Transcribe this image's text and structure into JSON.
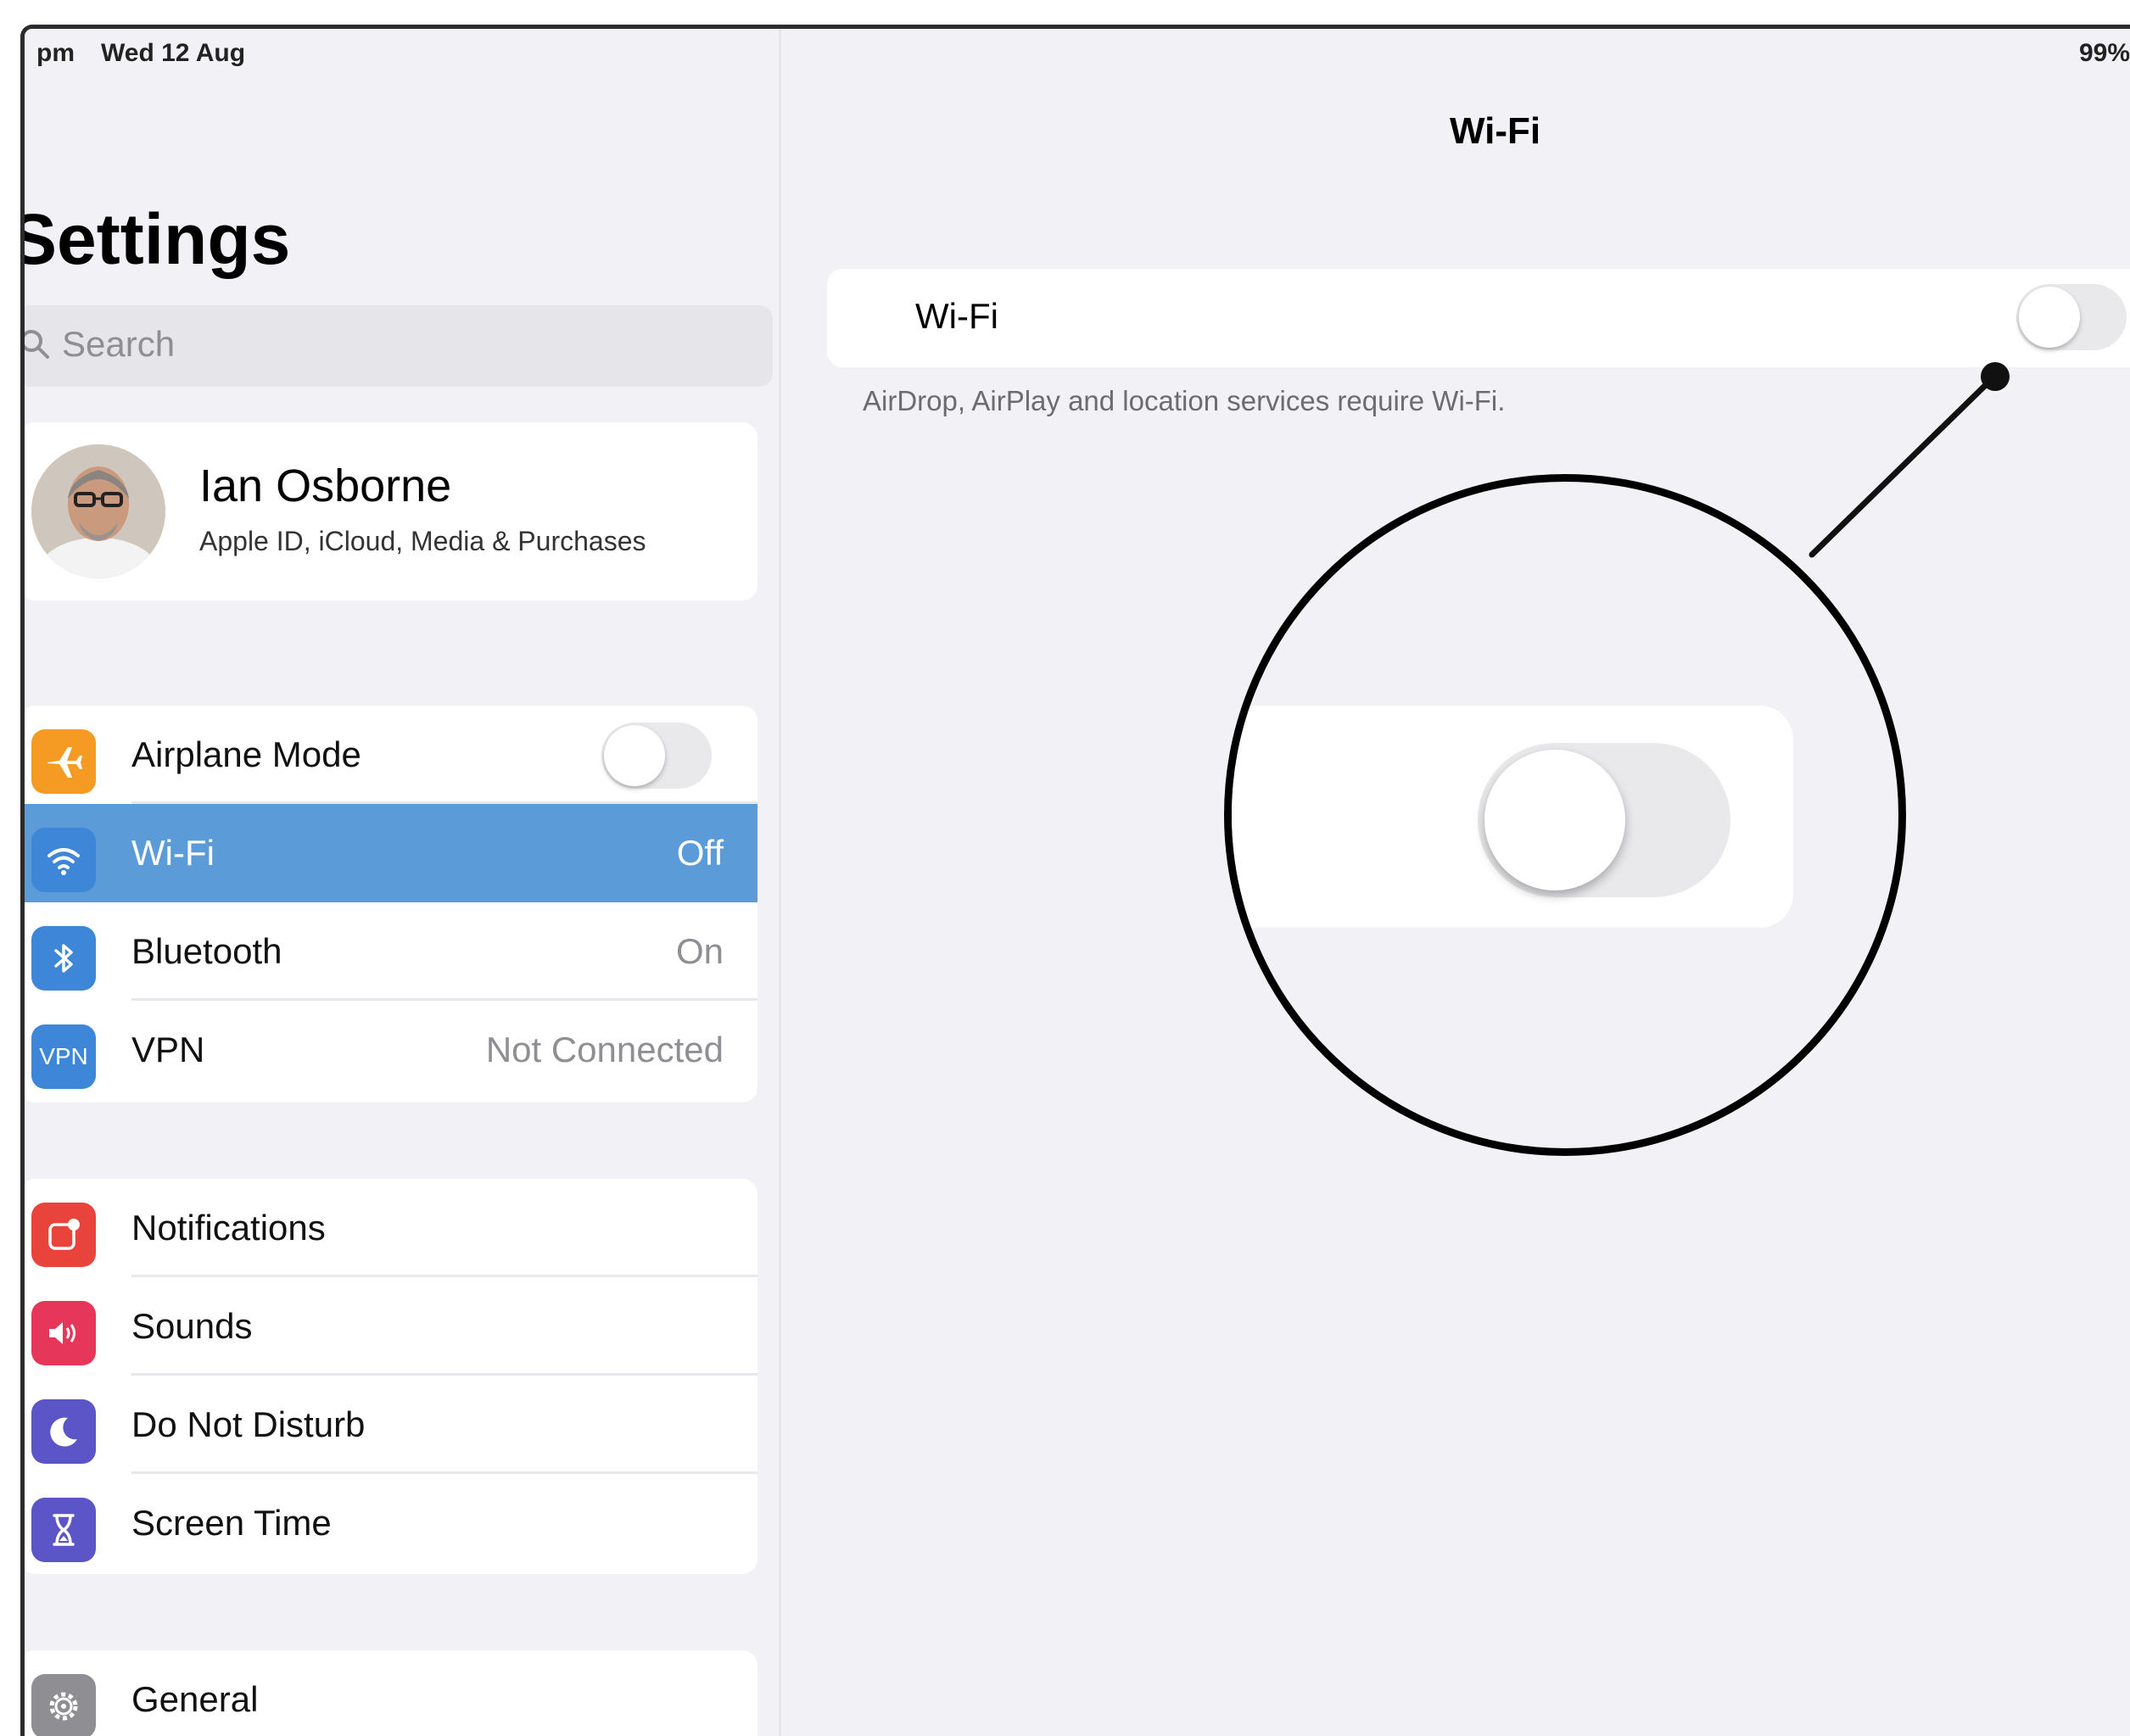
{
  "status_bar": {
    "time": "pm",
    "date": "Wed 12 Aug",
    "battery": "99%"
  },
  "sidebar": {
    "title": "Settings",
    "search_placeholder": "Search",
    "profile": {
      "name": "Ian Osborne",
      "subtitle": "Apple ID, iCloud, Media & Purchases"
    },
    "groups": [
      [
        {
          "label": "Airplane Mode",
          "icon": "airplane-icon",
          "color": "#f59a23",
          "toggle": false
        },
        {
          "label": "Wi-Fi",
          "value": "Off",
          "icon": "wifi-icon",
          "color": "#3d86d8",
          "selected": true
        },
        {
          "label": "Bluetooth",
          "value": "On",
          "icon": "bluetooth-icon",
          "color": "#3d86d8"
        },
        {
          "label": "VPN",
          "value": "Not Connected",
          "icon": "vpn-icon",
          "color": "#3d86d8",
          "icon_text": "VPN"
        }
      ],
      [
        {
          "label": "Notifications",
          "icon": "notifications-icon",
          "color": "#e9443b"
        },
        {
          "label": "Sounds",
          "icon": "speaker-icon",
          "color": "#e6375a"
        },
        {
          "label": "Do Not Disturb",
          "icon": "moon-icon",
          "color": "#5b55c7"
        },
        {
          "label": "Screen Time",
          "icon": "hourglass-icon",
          "color": "#5b55c7"
        }
      ],
      [
        {
          "label": "General",
          "icon": "gear-icon",
          "color": "#8e8e93"
        }
      ]
    ]
  },
  "detail": {
    "title": "Wi-Fi",
    "wifi_label": "Wi-Fi",
    "wifi_enabled": false,
    "footnote": "AirDrop, AirPlay and location services require Wi-Fi."
  }
}
